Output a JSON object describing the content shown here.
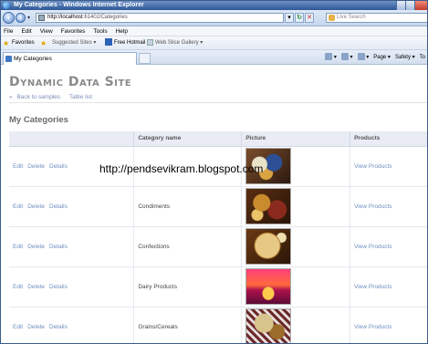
{
  "window": {
    "title": "My Categories - Windows Internet Explorer"
  },
  "address": {
    "url_host": "http://localhost",
    "url_rest": ":61402/Categories",
    "search_placeholder": "Live Search"
  },
  "menu": [
    "File",
    "Edit",
    "View",
    "Favorites",
    "Tools",
    "Help"
  ],
  "favorites": {
    "label": "Favorites",
    "suggested": "Suggested Sites ▾",
    "hotmail": "Free Hotmail",
    "slice": "Web Slice Gallery ▾"
  },
  "tab": {
    "title": "My Categories"
  },
  "commands": {
    "page": "Page ▾",
    "safety": "Safety ▾",
    "tools": "To"
  },
  "site": {
    "title": "Dynamic Data Site",
    "back_link": "Back to samples",
    "table_link": "Table list",
    "section_title": "My Categories"
  },
  "grid": {
    "headers": {
      "actions": "",
      "name": "Category name",
      "picture": "Picture",
      "products": "Products"
    },
    "action_labels": {
      "edit": "Edit",
      "delete": "Delete",
      "details": "Details"
    },
    "rows": [
      {
        "name": "",
        "picture": "beverages",
        "products": "View Products"
      },
      {
        "name": "Condiments",
        "picture": "condiments",
        "products": "View Products"
      },
      {
        "name": "Confections",
        "picture": "confections",
        "products": "View Products"
      },
      {
        "name": "Dairy Products",
        "picture": "dairy",
        "products": "View Products"
      },
      {
        "name": "Grains/Cereals",
        "picture": "grains",
        "products": "View Products"
      }
    ]
  },
  "overlay": {
    "watermark": "http://pendsevikram.blogspot.com"
  },
  "colors": {
    "link": "#6f8fc0",
    "header_bg": "#e9ecf5",
    "title_gray": "#8a8a8a"
  }
}
